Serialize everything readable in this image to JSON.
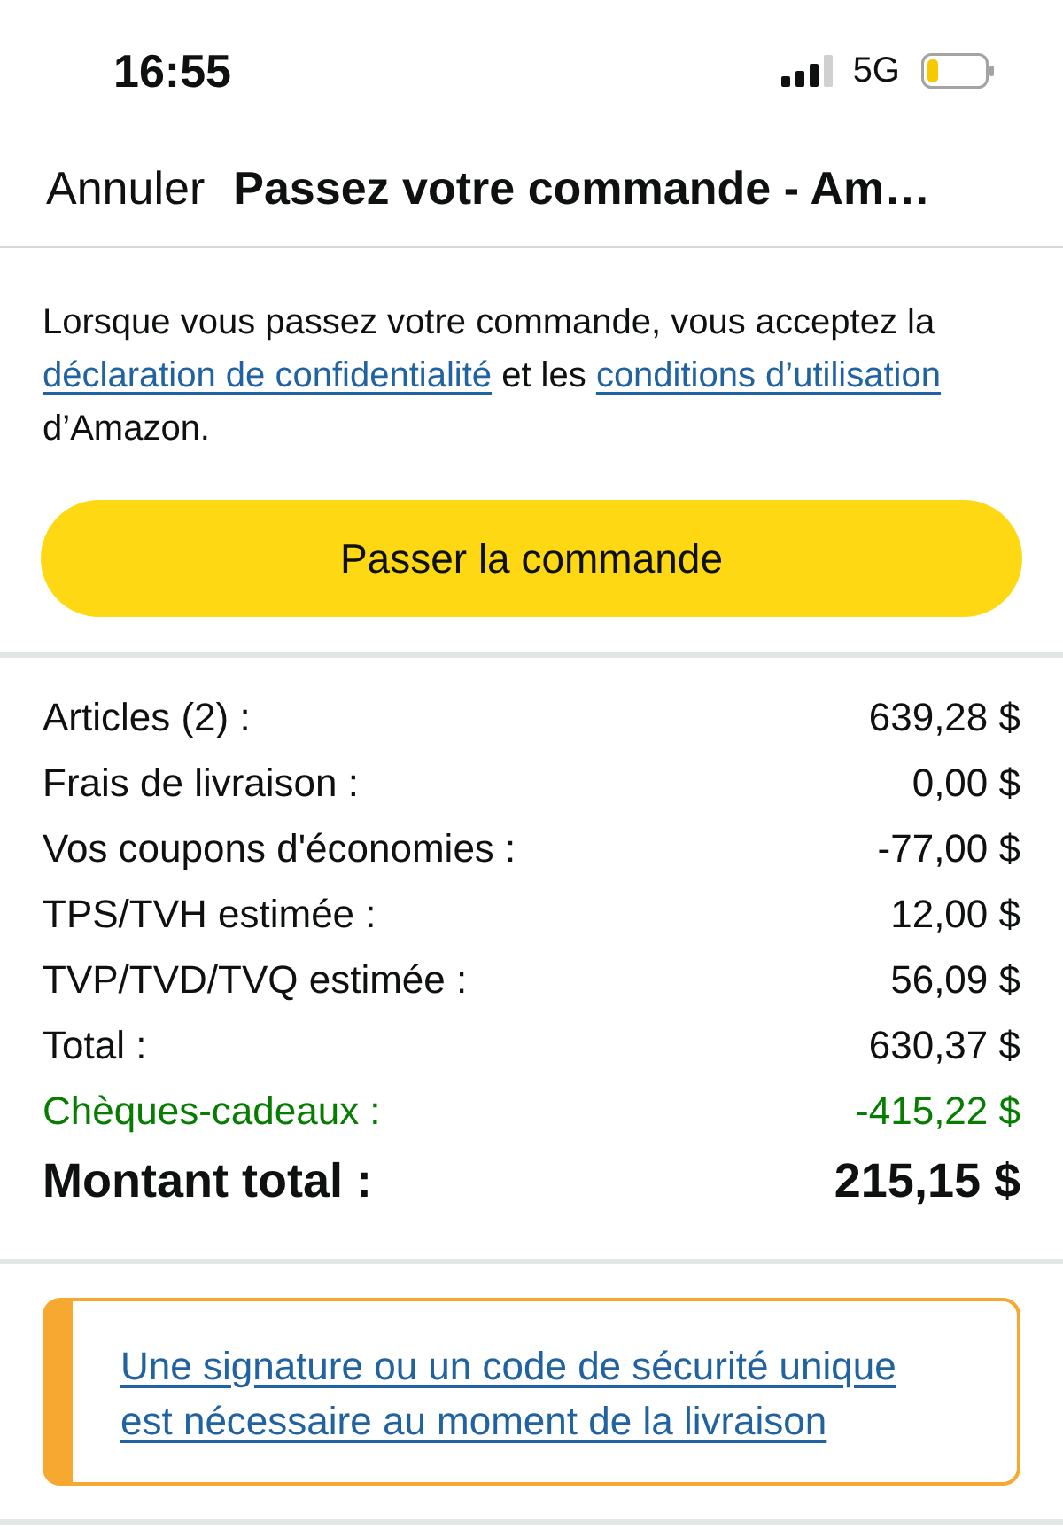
{
  "status_bar": {
    "time": "16:55",
    "network": "5G"
  },
  "nav_bar": {
    "cancel": "Annuler",
    "title": "Passez votre commande - Am…"
  },
  "agreement": {
    "segments": [
      {
        "kind": "text",
        "text": "Lorsque vous passez votre commande, vous acceptez la "
      },
      {
        "kind": "link",
        "text": "déclaration de confidentialité"
      },
      {
        "kind": "text",
        "text": " et les "
      },
      {
        "kind": "link",
        "text": "conditions d’utilisation"
      },
      {
        "kind": "text",
        "text": " d’Amazon."
      }
    ]
  },
  "place_order_button": {
    "label": "Passer la commande"
  },
  "order_summary": {
    "rows": [
      {
        "kind": "line",
        "label": "Articles (2) :",
        "value": "639,28 $"
      },
      {
        "kind": "line",
        "label": "Frais de livraison :",
        "value": "0,00 $"
      },
      {
        "kind": "line",
        "label": "Vos coupons d'économies :",
        "value": "-77,00 $"
      },
      {
        "kind": "line",
        "label": "TPS/TVH estimée :",
        "value": "12,00 $"
      },
      {
        "kind": "line",
        "label": "TVP/TVD/TVQ estimée :",
        "value": "56,09 $"
      },
      {
        "kind": "line",
        "label": "Total :",
        "value": "630,37 $"
      },
      {
        "kind": "credit",
        "label": "Chèques-cadeaux :",
        "value": "-415,22 $"
      },
      {
        "kind": "grand_total",
        "label": "Montant total :",
        "value": "215,15 $"
      }
    ]
  },
  "notice": {
    "text": "Une signature ou un code de sécurité unique est nécessaire au moment de la livraison"
  }
}
